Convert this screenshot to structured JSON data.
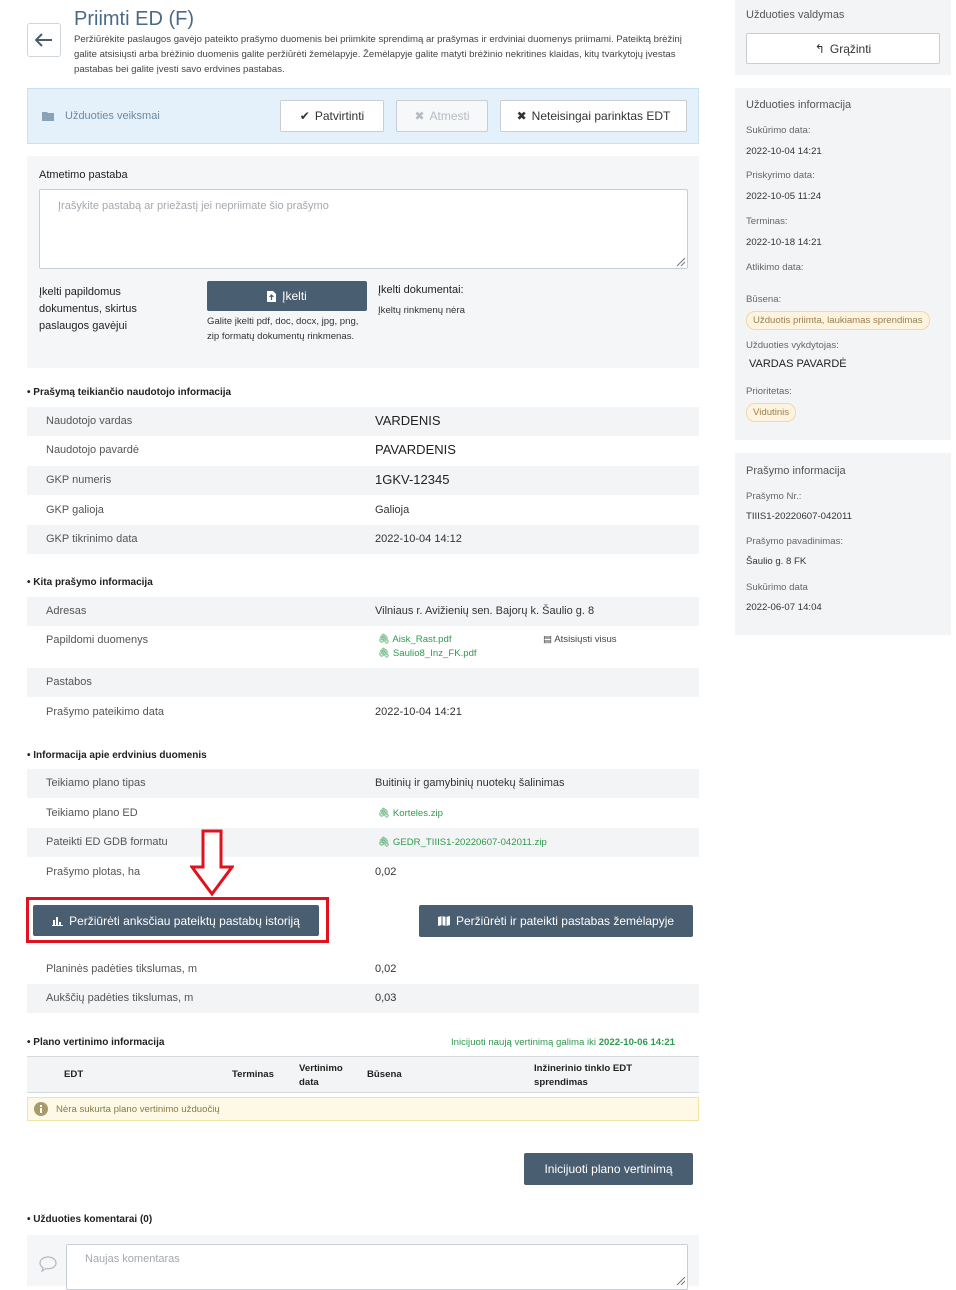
{
  "header": {
    "title": "Priimti ED (F)",
    "description": "Peržiūrėkite paslaugos gavėjo pateikto prašymo duomenis bei priimkite sprendimą ar prašymas ir erdviniai duomenys priimami. Pateiktą brėžinį galite atsisiųsti arba brėžinio duomenis galite peržiūrėti žemėlapyje. Žemėlapyje galite matyti brėžinio nekritines klaidas, kitų tvarkytojų įvestas pastabas bei galite įvesti savo erdvines pastabas."
  },
  "actions": {
    "label": "Užduoties veiksmai",
    "confirm": "Patvirtinti",
    "reject": "Atmesti",
    "wrong_edt": "Neteisingai parinktas EDT"
  },
  "rejection": {
    "label": "Atmetimo pastaba",
    "placeholder": "Įrašykite pastabą ar priežastį jei nepriimate šio prašymo",
    "upload_label": "Įkelti papildomus dokumentus, skirtus paslaugos gavėjui",
    "upload_button": "Įkelti",
    "upload_hint": "Galite įkelti pdf, doc, docx, jpg, png, zip formatų dokumentų rinkmenas.",
    "uploaded_title": "Įkelti dokumentai:",
    "uploaded_none": "Įkeltų rinkmenų nėra"
  },
  "applicant": {
    "heading": "Prašymą teikiančio naudotojo informacija",
    "rows": [
      {
        "k": "Naudotojo vardas",
        "v": "VARDENIS"
      },
      {
        "k": "Naudotojo pavardė",
        "v": "PAVARDENIS"
      },
      {
        "k": "GKP numeris",
        "v": "1GKV-12345"
      },
      {
        "k": "GKP galioja",
        "v": "Galioja"
      },
      {
        "k": "GKP tikrinimo data",
        "v": "2022-10-04 14:12"
      }
    ]
  },
  "other": {
    "heading": "Kita prašymo informacija",
    "address_k": "Adresas",
    "address_v": "Vilniaus r. Avižienių sen. Bajorų k. Šaulio g. 8",
    "extra_k": "Papildomi duomenys",
    "file1": "Aisk_Rast.pdf",
    "file2": "Saulio8_Inz_FK.pdf",
    "download_all": "Atsisiųsti visus",
    "notes_k": "Pastabos",
    "date_k": "Prašymo pateikimo data",
    "date_v": "2022-10-04 14:21"
  },
  "spatial": {
    "heading": "Informacija apie erdvinius duomenis",
    "plan_type_k": "Teikiamo plano tipas",
    "plan_type_v": "Buitinių ir gamybinių nuotekų šalinimas",
    "plan_ed_k": "Teikiamo plano ED",
    "plan_ed_v": "Korteles.zip",
    "gdb_k": "Pateikti ED GDB formatu",
    "gdb_v": "GEDR_TIIIS1-20220607-042011.zip",
    "area_k": "Prašymo plotas, ha",
    "area_v": "0,02",
    "history_button": "Peržiūrėti anksčiau pateiktų pastabų istoriją",
    "map_button": "Peržiūrėti ir pateikti pastabas žemėlapyje",
    "plan_acc_k": "Planinės padėties tikslumas, m",
    "plan_acc_v": "0,02",
    "alt_acc_k": "Aukščių padėties tikslumas, m",
    "alt_acc_v": "0,03"
  },
  "verification": {
    "heading": "Plano vertinimo informacija",
    "init_note": "Inicijuoti naują vertinimą galima iki",
    "init_date": "2022-10-06 14:21",
    "columns": [
      "EDT",
      "Terminas",
      "Vertinimo data",
      "Būsena",
      "Inžinerinio tinklo EDT sprendimas"
    ],
    "empty": "Nėra sukurta plano vertinimo užduočių",
    "init_button": "Inicijuoti plano vertinimą"
  },
  "comments": {
    "heading": "Užduoties komentarai (0)",
    "placeholder": "Naujas komentaras"
  },
  "sidebar": {
    "task_mgmt": {
      "heading": "Užduoties valdymas",
      "return_button": "Grąžinti"
    },
    "task_info": {
      "heading": "Užduoties informacija",
      "created_k": "Sukūrimo data:",
      "created_v": "2022-10-04 14:21",
      "assigned_k": "Priskyrimo data:",
      "assigned_v": "2022-10-05 11:24",
      "deadline_k": "Terminas:",
      "deadline_v": "2022-10-18 14:21",
      "done_k": "Atlikimo data:",
      "status_k": "Būsena:",
      "status_v": "Užduotis priimta, laukiamas sprendimas",
      "executor_k": "Užduoties vykdytojas:",
      "executor_v": "VARDAS PAVARDĖ",
      "priority_k": "Prioritetas:",
      "priority_v": "Vidutinis"
    },
    "request_info": {
      "heading": "Prašymo informacija",
      "no_k": "Prašymo Nr.:",
      "no_v": "TIIIS1-20220607-042011",
      "name_k": "Prašymo pavadinimas:",
      "name_v": "Šaulio g. 8 FK",
      "created_k": "Sukūrimo data",
      "created_v": "2022-06-07 14:04"
    }
  },
  "colors": {
    "accent": "#4a5e71",
    "title": "#4a6a86",
    "link": "#2e9a4c",
    "highlight": "#e0121f"
  }
}
